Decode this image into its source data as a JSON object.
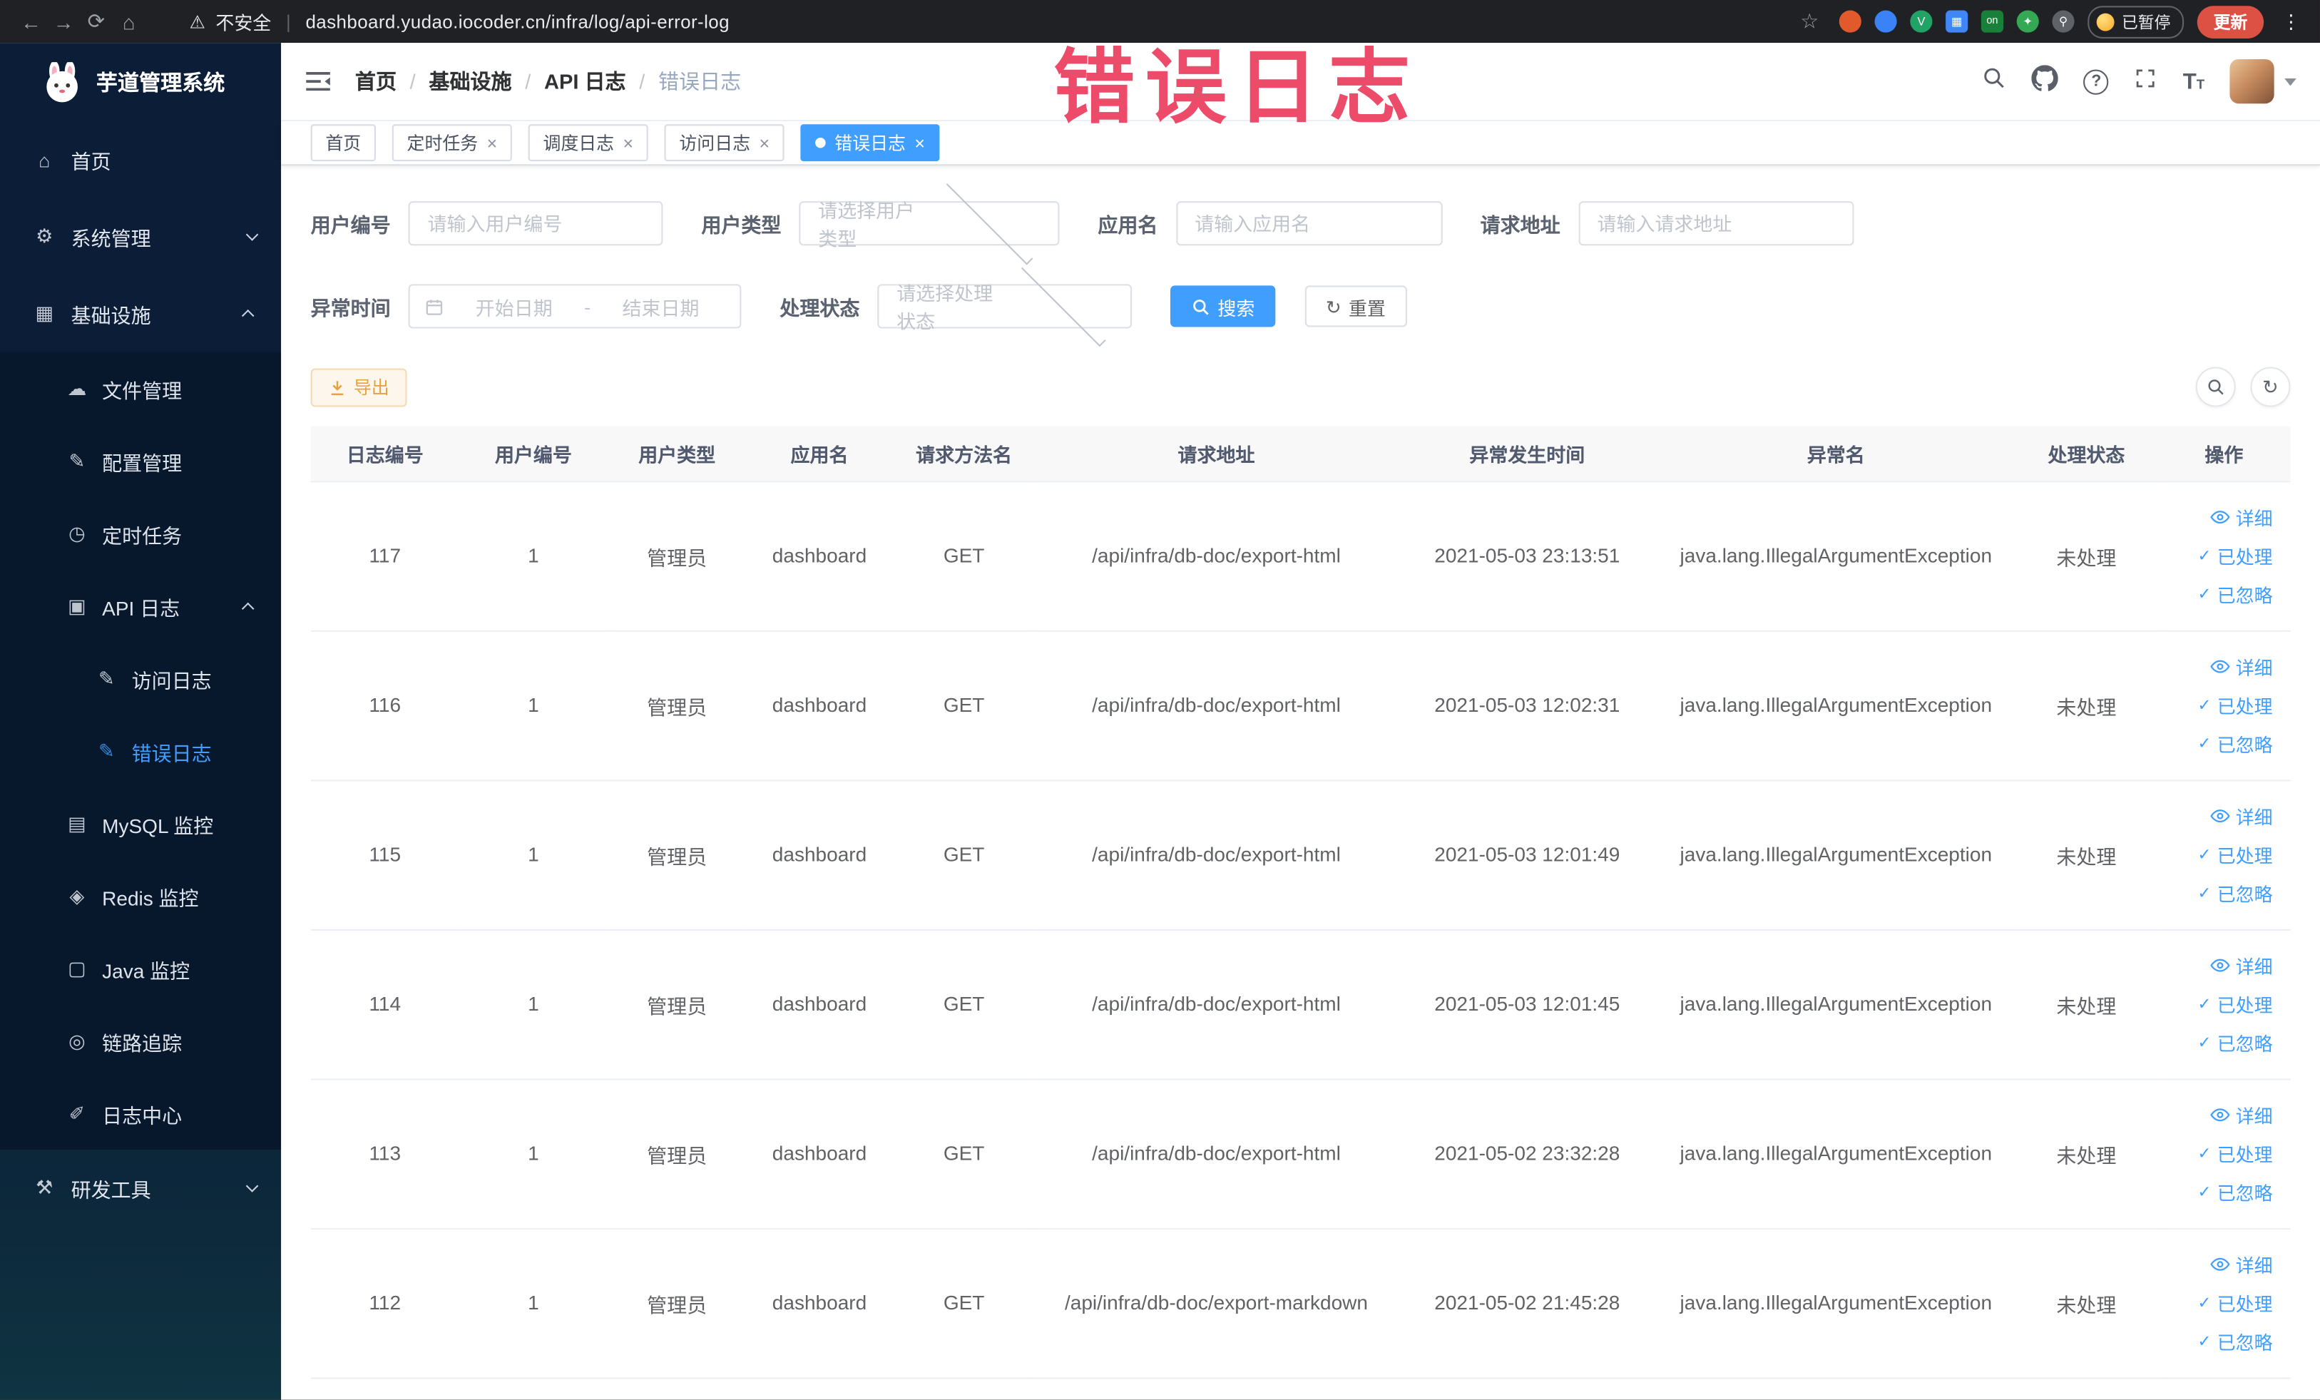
{
  "browser": {
    "security_label": "不安全",
    "url": "dashboard.yudao.iocoder.cn/infra/log/api-error-log",
    "ext_on_label": "on",
    "paused_badge": "已暂停",
    "update_label": "更新"
  },
  "annotation": "错误日志",
  "sidebar": {
    "app_title": "芋道管理系统",
    "home": "首页",
    "system": "系统管理",
    "infra": "基础设施",
    "file": "文件管理",
    "config": "配置管理",
    "job": "定时任务",
    "api_log": "API 日志",
    "access_log": "访问日志",
    "error_log": "错误日志",
    "mysql": "MySQL 监控",
    "redis": "Redis 监控",
    "java": "Java 监控",
    "trace": "链路追踪",
    "log_center": "日志中心",
    "devtools": "研发工具"
  },
  "breadcrumb": [
    "首页",
    "基础设施",
    "API 日志",
    "错误日志"
  ],
  "tabs": [
    {
      "label": "首页"
    },
    {
      "label": "定时任务"
    },
    {
      "label": "调度日志"
    },
    {
      "label": "访问日志"
    },
    {
      "label": "错误日志"
    }
  ],
  "filters": {
    "user_id_label": "用户编号",
    "user_id_placeholder": "请输入用户编号",
    "user_type_label": "用户类型",
    "user_type_placeholder": "请选择用户类型",
    "app_name_label": "应用名",
    "app_name_placeholder": "请输入应用名",
    "request_url_label": "请求地址",
    "request_url_placeholder": "请输入请求地址",
    "exception_time_label": "异常时间",
    "date_start_placeholder": "开始日期",
    "date_separator": "-",
    "date_end_placeholder": "结束日期",
    "status_label": "处理状态",
    "status_placeholder": "请选择处理状态",
    "search_label": "搜索",
    "reset_label": "重置"
  },
  "toolbar": {
    "export_label": "导出"
  },
  "table": {
    "columns": [
      "日志编号",
      "用户编号",
      "用户类型",
      "应用名",
      "请求方法名",
      "请求地址",
      "异常发生时间",
      "异常名",
      "处理状态",
      "操作"
    ],
    "action_labels": {
      "detail": "详细",
      "process": "已处理",
      "ignore": "已忽略"
    },
    "rows": [
      {
        "log_id": "117",
        "user_id": "1",
        "user_type": "管理员",
        "app_name": "dashboard",
        "method": "GET",
        "url": "/api/infra/db-doc/export-html",
        "time": "2021-05-03 23:13:51",
        "exception": "java.lang.IllegalArgumentException",
        "status": "未处理"
      },
      {
        "log_id": "116",
        "user_id": "1",
        "user_type": "管理员",
        "app_name": "dashboard",
        "method": "GET",
        "url": "/api/infra/db-doc/export-html",
        "time": "2021-05-03 12:02:31",
        "exception": "java.lang.IllegalArgumentException",
        "status": "未处理"
      },
      {
        "log_id": "115",
        "user_id": "1",
        "user_type": "管理员",
        "app_name": "dashboard",
        "method": "GET",
        "url": "/api/infra/db-doc/export-html",
        "time": "2021-05-03 12:01:49",
        "exception": "java.lang.IllegalArgumentException",
        "status": "未处理"
      },
      {
        "log_id": "114",
        "user_id": "1",
        "user_type": "管理员",
        "app_name": "dashboard",
        "method": "GET",
        "url": "/api/infra/db-doc/export-html",
        "time": "2021-05-03 12:01:45",
        "exception": "java.lang.IllegalArgumentException",
        "status": "未处理"
      },
      {
        "log_id": "113",
        "user_id": "1",
        "user_type": "管理员",
        "app_name": "dashboard",
        "method": "GET",
        "url": "/api/infra/db-doc/export-html",
        "time": "2021-05-02 23:32:28",
        "exception": "java.lang.IllegalArgumentException",
        "status": "未处理"
      },
      {
        "log_id": "112",
        "user_id": "1",
        "user_type": "管理员",
        "app_name": "dashboard",
        "method": "GET",
        "url": "/api/infra/db-doc/export-markdown",
        "time": "2021-05-02 21:45:28",
        "exception": "java.lang.IllegalArgumentException",
        "status": "未处理"
      }
    ]
  },
  "colors": {
    "accent": "#409eff",
    "warning": "#e6a23c",
    "annotation": "#ec3c5d",
    "sidebar": "#0b1d37"
  }
}
